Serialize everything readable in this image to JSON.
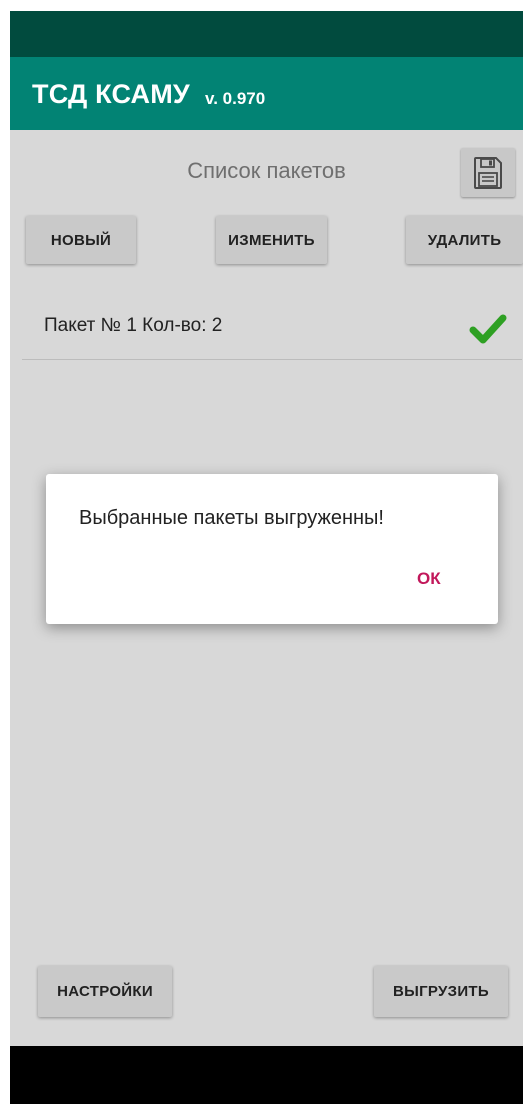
{
  "app": {
    "title": "ТСД КСАМУ",
    "version": "v. 0.970"
  },
  "screen": {
    "list_title": "Список пакетов"
  },
  "toolbar": {
    "new_label": "новый",
    "edit_label": "изменить",
    "delete_label": "удалить"
  },
  "packages": [
    {
      "label": "Пакет № 1 Кол-во: 2",
      "status": "check-icon"
    }
  ],
  "footer": {
    "settings_label": "настройки",
    "upload_label": "выгрузить"
  },
  "dialog": {
    "message": "Выбранные пакеты выгруженны!",
    "ok_label": "ОК"
  },
  "colors": {
    "appbar": "#028374",
    "statusbar": "#014b3e",
    "check": "#2ea023",
    "dialog_ok": "#c2185b"
  }
}
